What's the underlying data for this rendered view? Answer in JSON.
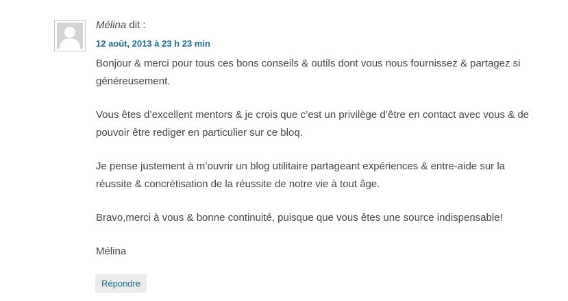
{
  "comment": {
    "avatar_icon": "default-person-avatar-icon",
    "author": "Mélina",
    "says": " dit :",
    "date": "12 août, 2013 à 23 h 23 min",
    "paragraphs": [
      "Bonjour & merci pour tous ces bons conseils & outils dont vous nous fournissez & partagez si généreusement.",
      "Vous êtes d’excellent mentors & je crois que c’est un privilège d’être en contact avec vous & de pouvoir être rediger en particulier sur ce bloq.",
      "Je pense justement à m’ouvrir un blog utilitaire partageant expériences & entre-aide sur la réussite & concrétisation de la réussite de notre vie à tout âge.",
      "Bravo,merci à vous & bonne continuité, puisque que vous êtes une source indispensable!",
      "Mélina"
    ],
    "reply_label": "Répondre"
  },
  "colors": {
    "text": "#444444",
    "link": "#1e6a8d",
    "reply_bg": "#ebebeb",
    "avatar_bg": "#d4d4d4"
  }
}
